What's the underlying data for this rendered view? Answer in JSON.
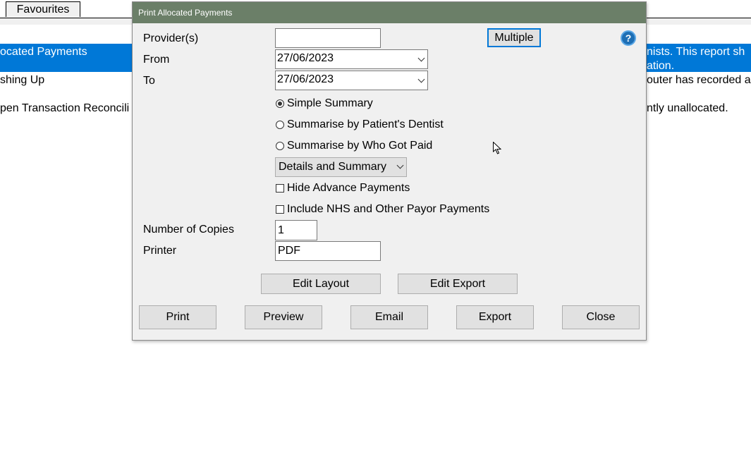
{
  "background": {
    "tab": "Favourites",
    "selected_row_left": "ocated Payments",
    "selected_row_right_line1": "nists. This report sh",
    "selected_row_right_line2": "ation.",
    "row2_left": "shing Up",
    "row2_right": "outer has recorded a",
    "row3_left": "pen Transaction Reconcili",
    "row3_right": "ntly unallocated."
  },
  "dialog": {
    "title": "Print Allocated Payments",
    "help_label": "?",
    "providers": {
      "label": "Provider(s)",
      "value": ""
    },
    "multiple_button": "Multiple",
    "from": {
      "label": "From",
      "value": "27/06/2023"
    },
    "to": {
      "label": "To",
      "value": "27/06/2023"
    },
    "radio_options": [
      {
        "label": "Simple Summary",
        "selected": true
      },
      {
        "label": "Summarise by Patient's Dentist",
        "selected": false
      },
      {
        "label": "Summarise by Who Got Paid",
        "selected": false
      }
    ],
    "detail_dropdown": "Details and Summary",
    "checkboxes": [
      {
        "label": "Hide Advance Payments",
        "checked": false
      },
      {
        "label": "Include NHS and Other Payor Payments",
        "checked": false
      }
    ],
    "copies": {
      "label": "Number of Copies",
      "value": "1"
    },
    "printer": {
      "label": "Printer",
      "value": "PDF"
    },
    "edit_layout_button": "Edit Layout",
    "edit_export_button": "Edit Export",
    "buttons": {
      "print": "Print",
      "preview": "Preview",
      "email": "Email",
      "export": "Export",
      "close": "Close"
    },
    "colors": {
      "titlebar": "#6b7f68",
      "accent": "#0078d7"
    }
  }
}
